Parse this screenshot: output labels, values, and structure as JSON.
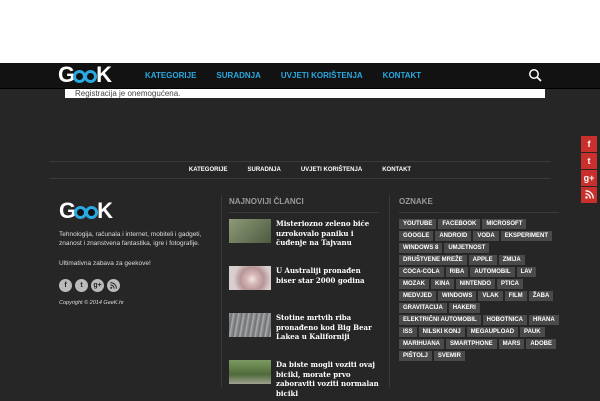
{
  "header": {
    "logo_text_left": "G",
    "logo_text_right": "K",
    "nav": [
      "KATEGORIJE",
      "SURADNJA",
      "UVJETI KORIŠTENJA",
      "KONTAKT"
    ]
  },
  "notice": "Registracija je onemogućena.",
  "side_social": [
    "f",
    "t",
    "g+",
    "rss"
  ],
  "footer_nav": [
    "KATEGORIJE",
    "SURADNJA",
    "UVJETI KORIŠTENJA",
    "KONTAKT"
  ],
  "about": {
    "logo_text_left": "G",
    "logo_text_right": "K",
    "description": "Tehnologija, računala i internet, mobiteli i gadgeti, znanost i znanstvena fantastika, igre i fotografije.",
    "tagline": "Ultimativna zabava za geekove!",
    "social": [
      "f",
      "t",
      "g+",
      "rss"
    ],
    "copyright": "Copyright © 2014 GeeK.hr"
  },
  "latest": {
    "title": "NAJNOVIJI ČLANCI",
    "articles": [
      {
        "title": "Misteriozno zeleno biće uzrokovalo paniku i čuđenje na Tajvanu",
        "thumb_color": "#6e7c5c"
      },
      {
        "title": "U Australiji pronađen biser star 2000 godina",
        "thumb_color": "#c8a9a8"
      },
      {
        "title": "Stotine mrtvih riba pronađeno kod Big Bear Lakea u Kaliforniji",
        "thumb_color": "#8a8d8f"
      },
      {
        "title": "Da biste mogli voziti ovaj bicikl, morate prvo zaboraviti voziti normalan bicikl",
        "thumb_color": "#5f7a4a"
      }
    ]
  },
  "tags": {
    "title": "OZNAKE",
    "items": [
      "YOUTUBE",
      "FACEBOOK",
      "MICROSOFT",
      "GOOGLE",
      "ANDROID",
      "VODA",
      "EKSPERIMENT",
      "WINDOWS 8",
      "UMJETNOST",
      "DRUŠTVENE MREŽE",
      "APPLE",
      "ZMIJA",
      "COCA-COLA",
      "RIBA",
      "AUTOMOBIL",
      "LAV",
      "MOZAK",
      "KINA",
      "NINTENDO",
      "PTICA",
      "MEDVJED",
      "WINDOWS",
      "VLAK",
      "FILM",
      "ŽABA",
      "GRAVITACIJA",
      "HAKERI",
      "ELEKTRIČNI AUTOMOBIL",
      "HOBOTNICA",
      "HRANA",
      "ISS",
      "NILSKI KONJ",
      "MEGAUPLOAD",
      "PAUK",
      "MARIHUANA",
      "SMARTPHONE",
      "MARS",
      "ADOBE",
      "PIŠTOLJ",
      "SVEMIR"
    ]
  }
}
